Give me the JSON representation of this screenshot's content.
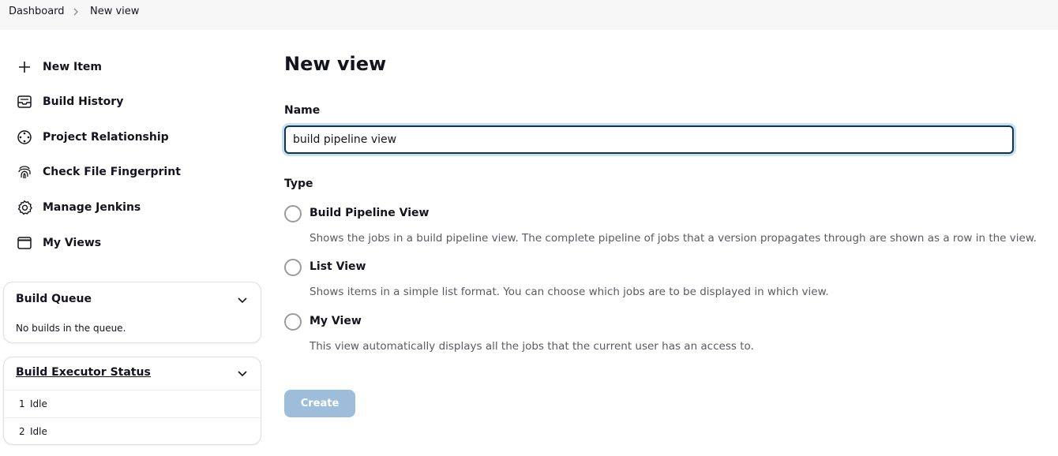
{
  "breadcrumb": {
    "items": [
      "Dashboard",
      "New view"
    ]
  },
  "sidebar": {
    "items": [
      {
        "label": "New Item",
        "icon": "plus-icon"
      },
      {
        "label": "Build History",
        "icon": "inbox-icon"
      },
      {
        "label": "Project Relationship",
        "icon": "relationship-icon"
      },
      {
        "label": "Check File Fingerprint",
        "icon": "fingerprint-icon"
      },
      {
        "label": "Manage Jenkins",
        "icon": "gear-icon"
      },
      {
        "label": "My Views",
        "icon": "window-icon"
      }
    ]
  },
  "build_queue": {
    "title": "Build Queue",
    "empty_text": "No builds in the queue."
  },
  "executor_status": {
    "title": "Build Executor Status",
    "rows": [
      {
        "num": "1",
        "status": "Idle"
      },
      {
        "num": "2",
        "status": "Idle"
      }
    ]
  },
  "main": {
    "title": "New view",
    "name_label": "Name",
    "name_value": "build pipeline view",
    "type_label": "Type",
    "types": [
      {
        "label": "Build Pipeline View",
        "desc": "Shows the jobs in a build pipeline view. The complete pipeline of jobs that a version propagates through are shown as a row in the view."
      },
      {
        "label": "List View",
        "desc": "Shows items in a simple list format. You can choose which jobs are to be displayed in which view."
      },
      {
        "label": "My View",
        "desc": "This view automatically displays all the jobs that the current user has an access to."
      }
    ],
    "create_label": "Create"
  },
  "colors": {
    "accent_focus": "#0d3552",
    "button_disabled": "#9ebddb",
    "muted_text": "#5a5a66"
  }
}
